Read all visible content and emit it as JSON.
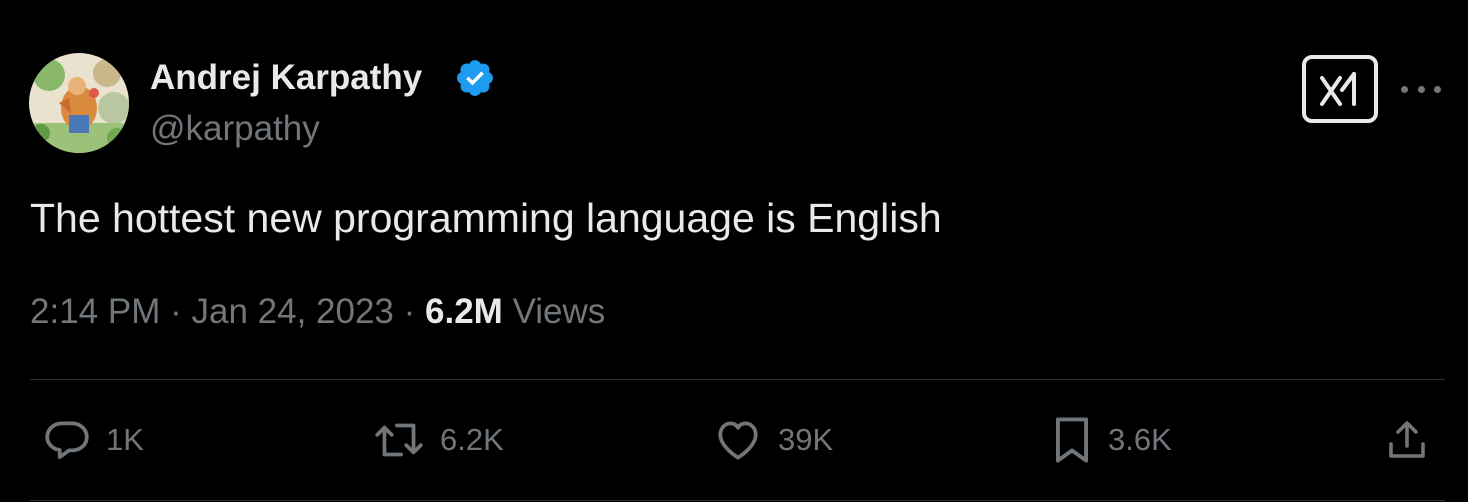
{
  "author": {
    "display_name": "Andrej Karpathy",
    "handle": "@karpathy",
    "verified": true,
    "avatar_icon": "illustrated-avatar"
  },
  "header_actions": {
    "grok_icon": "grok-icon",
    "more_icon": "more-dots-icon"
  },
  "tweet": {
    "text": "The hottest new programming language is English",
    "time": "2:14 PM",
    "separator": "·",
    "date": "Jan 24, 2023",
    "views_count": "6.2M",
    "views_label": "Views"
  },
  "actions": {
    "reply": {
      "icon": "reply-icon",
      "count": "1K"
    },
    "repost": {
      "icon": "repost-icon",
      "count": "6.2K"
    },
    "like": {
      "icon": "heart-icon",
      "count": "39K"
    },
    "bookmark": {
      "icon": "bookmark-icon",
      "count": "3.6K"
    },
    "share": {
      "icon": "share-icon"
    }
  },
  "colors": {
    "background": "#000000",
    "primary_text": "#e7e9ea",
    "secondary_text": "#71767b",
    "divider": "#2f3336",
    "verified_badge": "#1d9bf0"
  }
}
